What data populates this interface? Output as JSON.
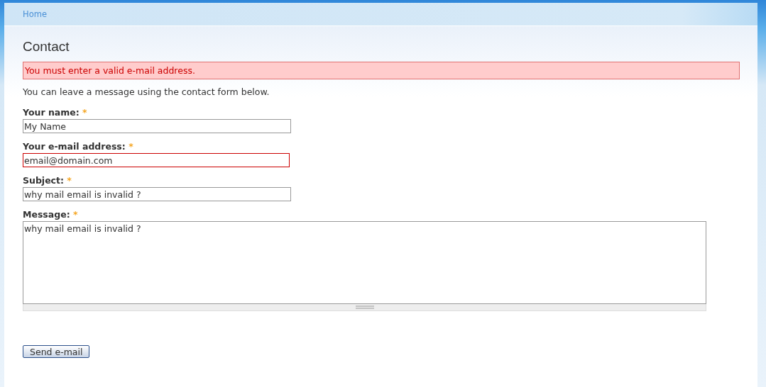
{
  "breadcrumb": [
    "Home"
  ],
  "title": "Contact",
  "error_message": "You must enter a valid e-mail address.",
  "intro": "You can leave a message using the contact form below.",
  "fields": [
    {
      "kind": "text",
      "label": "Your name:",
      "required_mark": "*",
      "value": "My Name",
      "error": false
    },
    {
      "kind": "text",
      "label": "Your e-mail address:",
      "required_mark": "*",
      "value": "email@domain.com",
      "error": true
    },
    {
      "kind": "text",
      "label": "Subject:",
      "required_mark": "*",
      "value": "why mail email is invalid ?",
      "error": false
    },
    {
      "kind": "textarea",
      "label": "Message:",
      "required_mark": "*",
      "value": "why mail email is invalid ?",
      "error": false
    }
  ],
  "submit": "Send e-mail"
}
